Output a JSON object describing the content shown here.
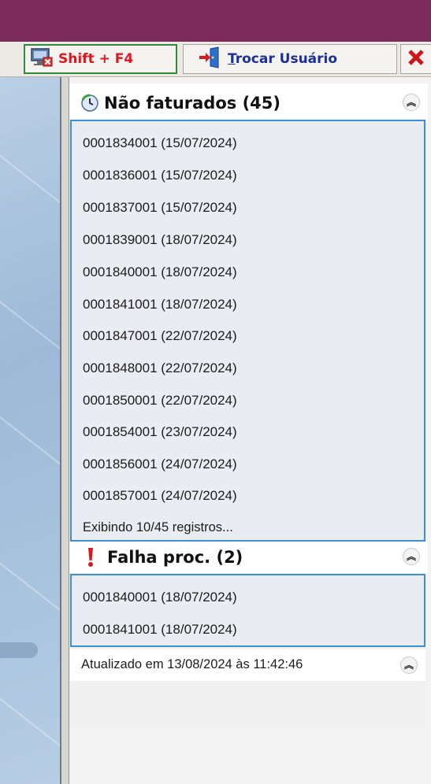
{
  "toolbar": {
    "shift_label": "Shift + F4",
    "trocar_prefix": "T",
    "trocar_rest": "rocar Usuário",
    "close_label": "✕"
  },
  "nao_faturados": {
    "title": "Não faturados (45)",
    "items": [
      "0001834001 (15/07/2024)",
      "0001836001 (15/07/2024)",
      "0001837001 (15/07/2024)",
      "0001839001 (18/07/2024)",
      "0001840001 (18/07/2024)",
      "0001841001 (18/07/2024)",
      "0001847001 (22/07/2024)",
      "0001848001 (22/07/2024)",
      "0001850001 (22/07/2024)",
      "0001854001 (23/07/2024)",
      "0001856001 (24/07/2024)",
      "0001857001 (24/07/2024)"
    ],
    "footer": "Exibindo 10/45 registros..."
  },
  "falha_proc": {
    "title": "Falha proc.  (2)",
    "items": [
      "0001840001 (18/07/2024)",
      "0001841001 (18/07/2024)"
    ]
  },
  "status": {
    "text": "Atualizado em 13/08/2024 às 11:42:46"
  },
  "colors": {
    "titlebar": "#7a2b5c",
    "shift_text": "#e0161f",
    "trocar_text": "#1a2f9c",
    "section_border": "#3c8fd6"
  },
  "icons": {
    "shift": "monitor-close-icon",
    "trocar": "door-exit-icon",
    "close": "close-icon",
    "nao_faturados": "clock-icon",
    "falha_proc": "exclamation-icon",
    "collapse": "chevron-double-up-icon"
  }
}
